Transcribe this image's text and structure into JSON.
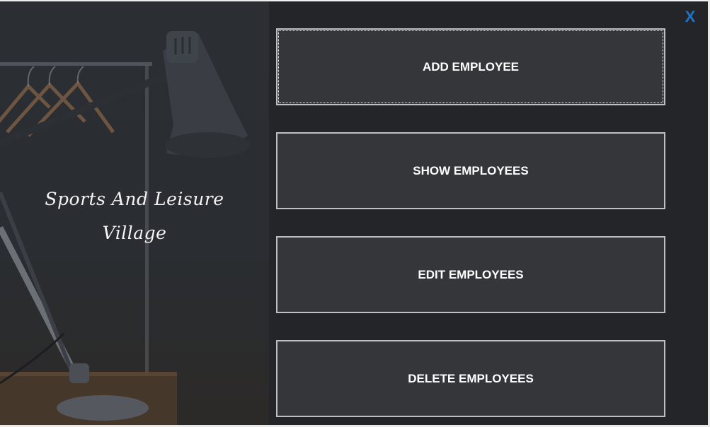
{
  "app": {
    "brand_line1": "Sports And Leisure",
    "brand_line2": "Village"
  },
  "menu": {
    "add_label": "ADD EMPLOYEE",
    "show_label": "SHOW EMPLOYEES",
    "edit_label": "EDIT EMPLOYEES",
    "delete_label": "DELETE EMPLOYEES"
  },
  "window": {
    "close_label": "X"
  },
  "colors": {
    "background": "#242528",
    "button": "#35363a",
    "button_border": "#bfc0c3",
    "close": "#1e74c8"
  },
  "icons": {
    "close": "close-icon",
    "photo": "desk-lamp-photo"
  }
}
